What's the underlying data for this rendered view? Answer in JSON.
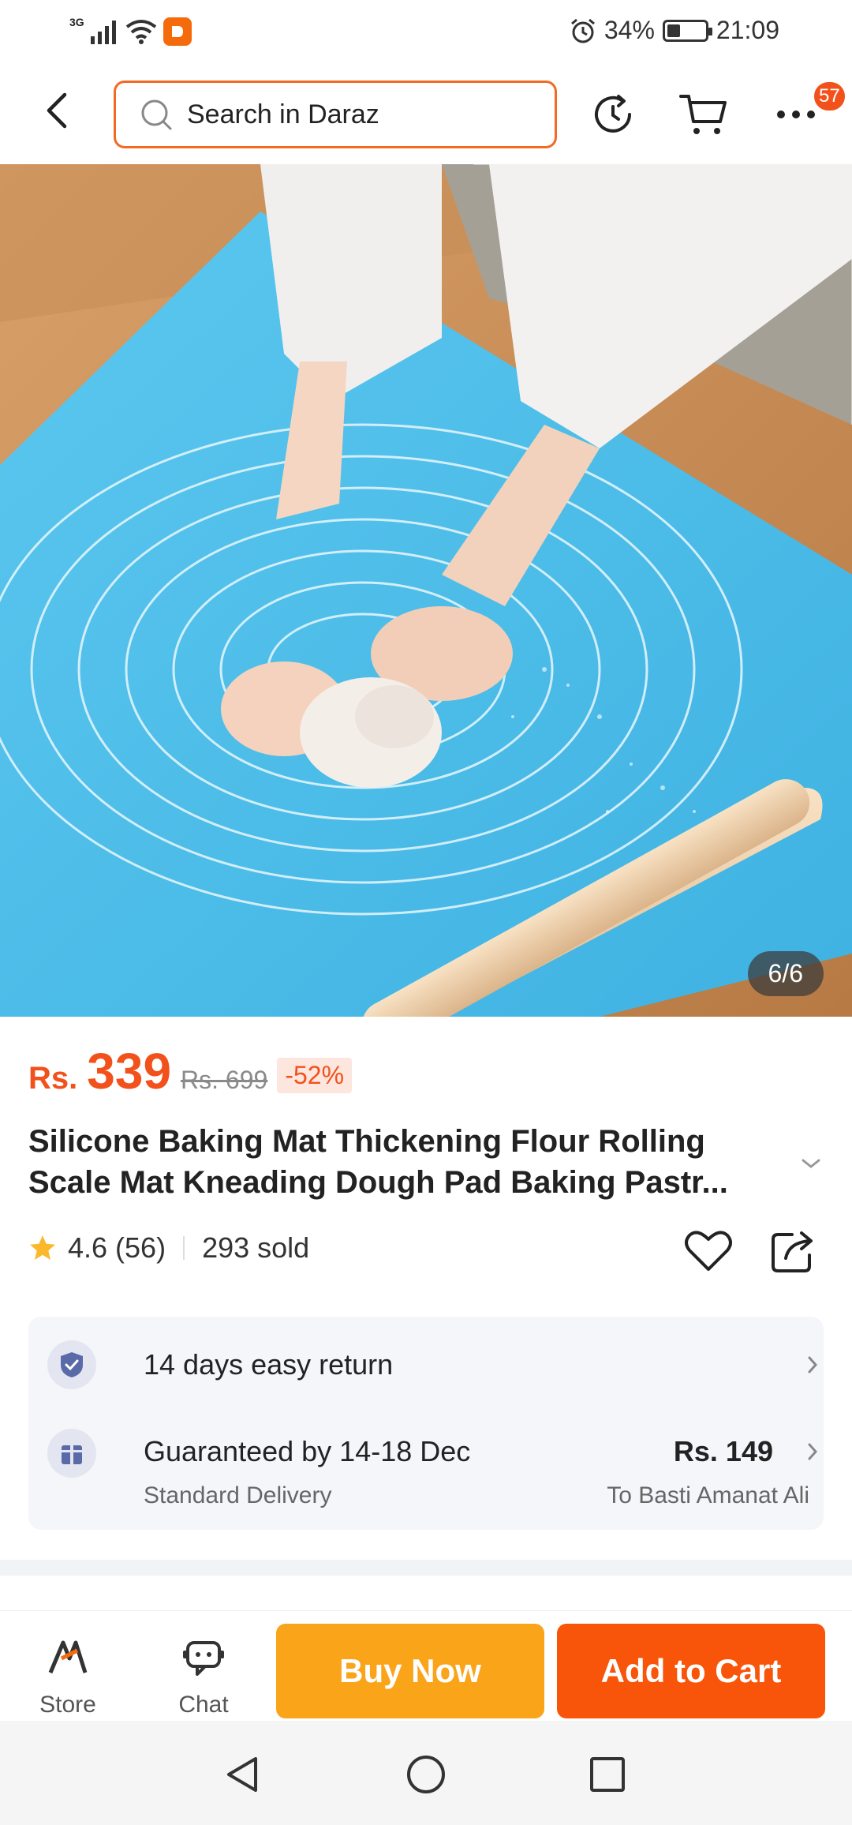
{
  "status_bar": {
    "network": "3G",
    "battery": "34%",
    "battery_level": 0.34,
    "time": "21:09"
  },
  "header": {
    "search_placeholder": "Search in Daraz",
    "more_badge": "57"
  },
  "hero": {
    "image_counter": "6/6"
  },
  "product": {
    "currency": "Rs.",
    "price": "339",
    "original_price": "Rs. 699",
    "discount": "-52%",
    "title_line1": "Silicone Baking Mat Thickening Flour Rolling",
    "title_line2": "Scale Mat Kneading Dough Pad Baking Pastr...",
    "rating": "4.6 (56)",
    "sold": "293 sold"
  },
  "services": {
    "return_text": "14 days easy return",
    "delivery_text": "Guaranteed by 14-18 Dec",
    "delivery_sub": "Standard Delivery",
    "delivery_price": "Rs. 149",
    "delivery_location": "To Basti Amanat Ali"
  },
  "bottom_bar": {
    "store_label": "Store",
    "chat_label": "Chat",
    "buy_now_label": "Buy Now",
    "add_to_cart_label": "Add to Cart"
  },
  "colors": {
    "accent": "#f2511b",
    "buy_now": "#faa41a",
    "add_to_cart": "#f8550a"
  }
}
